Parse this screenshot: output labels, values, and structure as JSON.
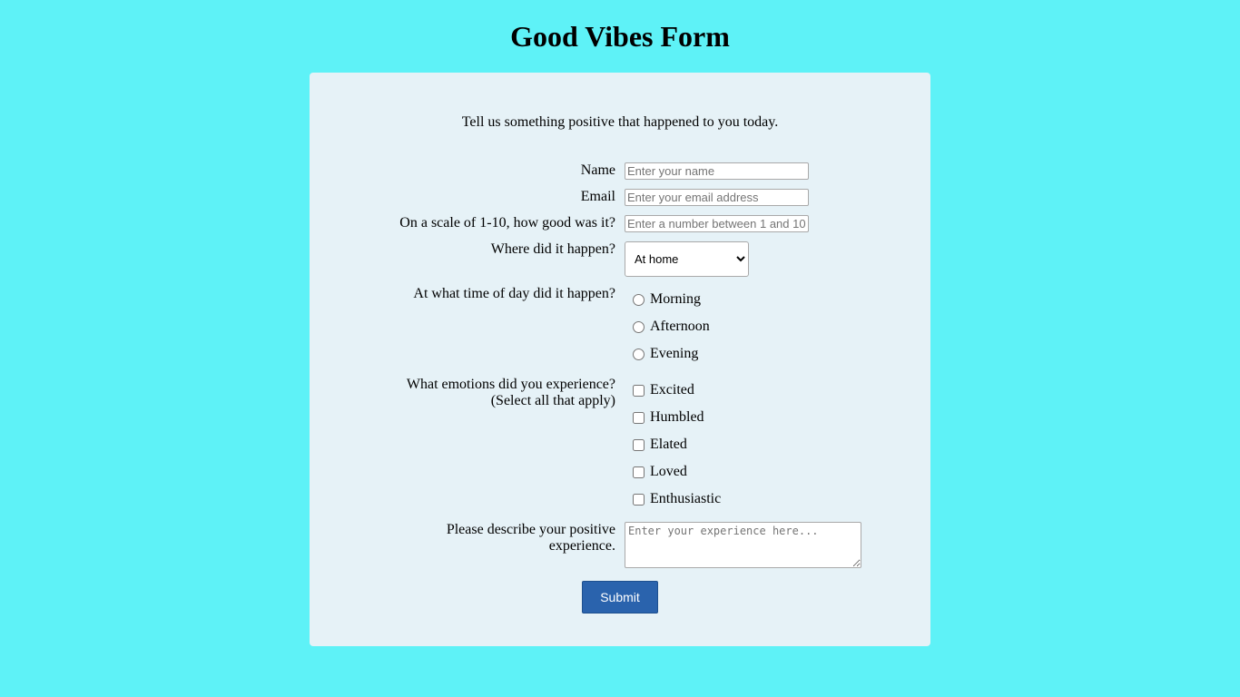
{
  "page": {
    "title": "Good Vibes Form",
    "background_color": "#5ef2f7",
    "card_color": "#e6f2f7",
    "accent_color": "#2a63ad"
  },
  "form": {
    "intro": "Tell us something positive that happened to you today.",
    "name": {
      "label": "Name",
      "placeholder": "Enter your name",
      "value": ""
    },
    "email": {
      "label": "Email",
      "placeholder": "Enter your email address",
      "value": ""
    },
    "rating": {
      "label": "On a scale of 1-10, how good was it?",
      "placeholder": "Enter a number between 1 and 10",
      "value": ""
    },
    "location": {
      "label": "Where did it happen?",
      "selected": "At home"
    },
    "time_of_day": {
      "label": "At what time of day did it happen?",
      "options": [
        "Morning",
        "Afternoon",
        "Evening"
      ]
    },
    "emotions": {
      "label_line1": "What emotions did you experience?",
      "label_line2": "(Select all that apply)",
      "options": [
        "Excited",
        "Humbled",
        "Elated",
        "Loved",
        "Enthusiastic"
      ]
    },
    "description": {
      "label": "Please describe your positive experience.",
      "placeholder": "Enter your experience here..."
    },
    "submit_label": "Submit"
  }
}
